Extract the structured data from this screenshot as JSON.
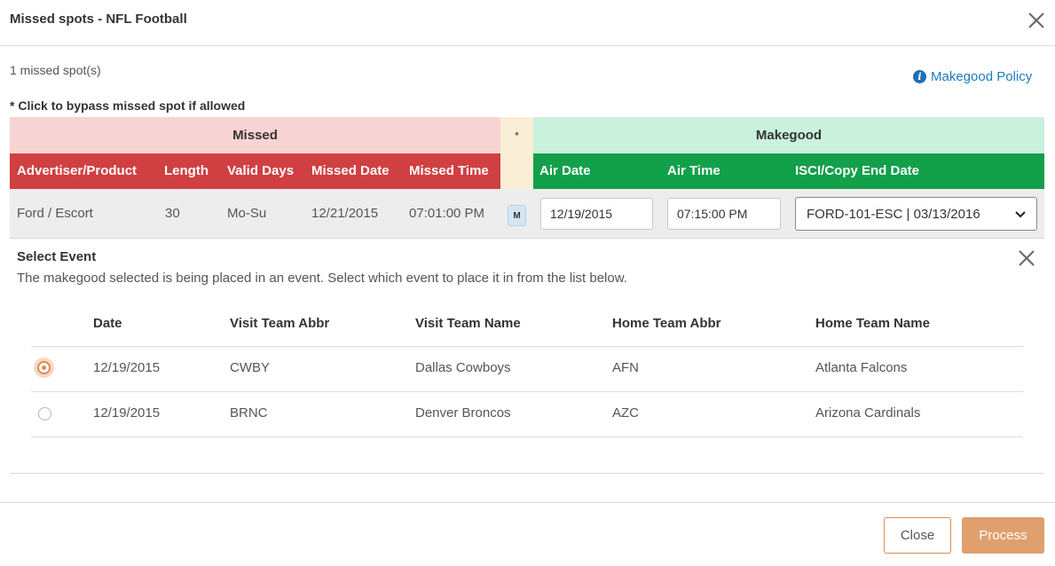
{
  "dialog": {
    "title": "Missed spots - NFL Football",
    "missed_count": "1 missed spot(s)",
    "policy_link": "Makegood Policy",
    "bypass_note": "* Click to bypass missed spot if allowed"
  },
  "groups": {
    "missed": "Missed",
    "star": "*",
    "makegood": "Makegood"
  },
  "columns": {
    "advertiser": "Advertiser/Product",
    "length": "Length",
    "valid_days": "Valid Days",
    "missed_date": "Missed Date",
    "missed_time": "Missed Time",
    "air_date": "Air Date",
    "air_time": "Air Time",
    "isci": "ISCI/Copy End Date"
  },
  "spot": {
    "advertiser": "Ford / Escort",
    "length": "30",
    "valid_days": "Mo-Su",
    "missed_date": "12/21/2015",
    "missed_time": "07:01:00 PM",
    "badge": "M",
    "air_date": "12/19/2015",
    "air_time": "07:15:00 PM",
    "isci": "FORD-101-ESC | 03/13/2016"
  },
  "event_picker": {
    "title": "Select Event",
    "description": "The makegood selected is being placed in an event. Select which event to place it in from the list below.",
    "headers": [
      "Date",
      "Visit Team Abbr",
      "Visit Team Name",
      "Home Team Abbr",
      "Home Team Name"
    ],
    "rows": [
      {
        "date": "12/19/2015",
        "visit_abbr": "CWBY",
        "visit_name": "Dallas Cowboys",
        "home_abbr": "AFN",
        "home_name": "Atlanta Falcons",
        "selected": true
      },
      {
        "date": "12/19/2015",
        "visit_abbr": "BRNC",
        "visit_name": "Denver Broncos",
        "home_abbr": "AZC",
        "home_name": "Arizona Cardinals",
        "selected": false
      }
    ]
  },
  "buttons": {
    "close": "Close",
    "process": "Process"
  },
  "colors": {
    "missed_group_bg": "#f8d3d3",
    "missed_header_bg": "#d03f42",
    "makegood_group_bg": "#c9f1dc",
    "makegood_header_bg": "#13a04a",
    "star_bg": "#faefd6",
    "accent": "#d98b54",
    "link": "#1f7bbf"
  },
  "icons": {
    "close": "close-icon",
    "info": "info-icon",
    "dropdown": "chevron-down-icon"
  }
}
